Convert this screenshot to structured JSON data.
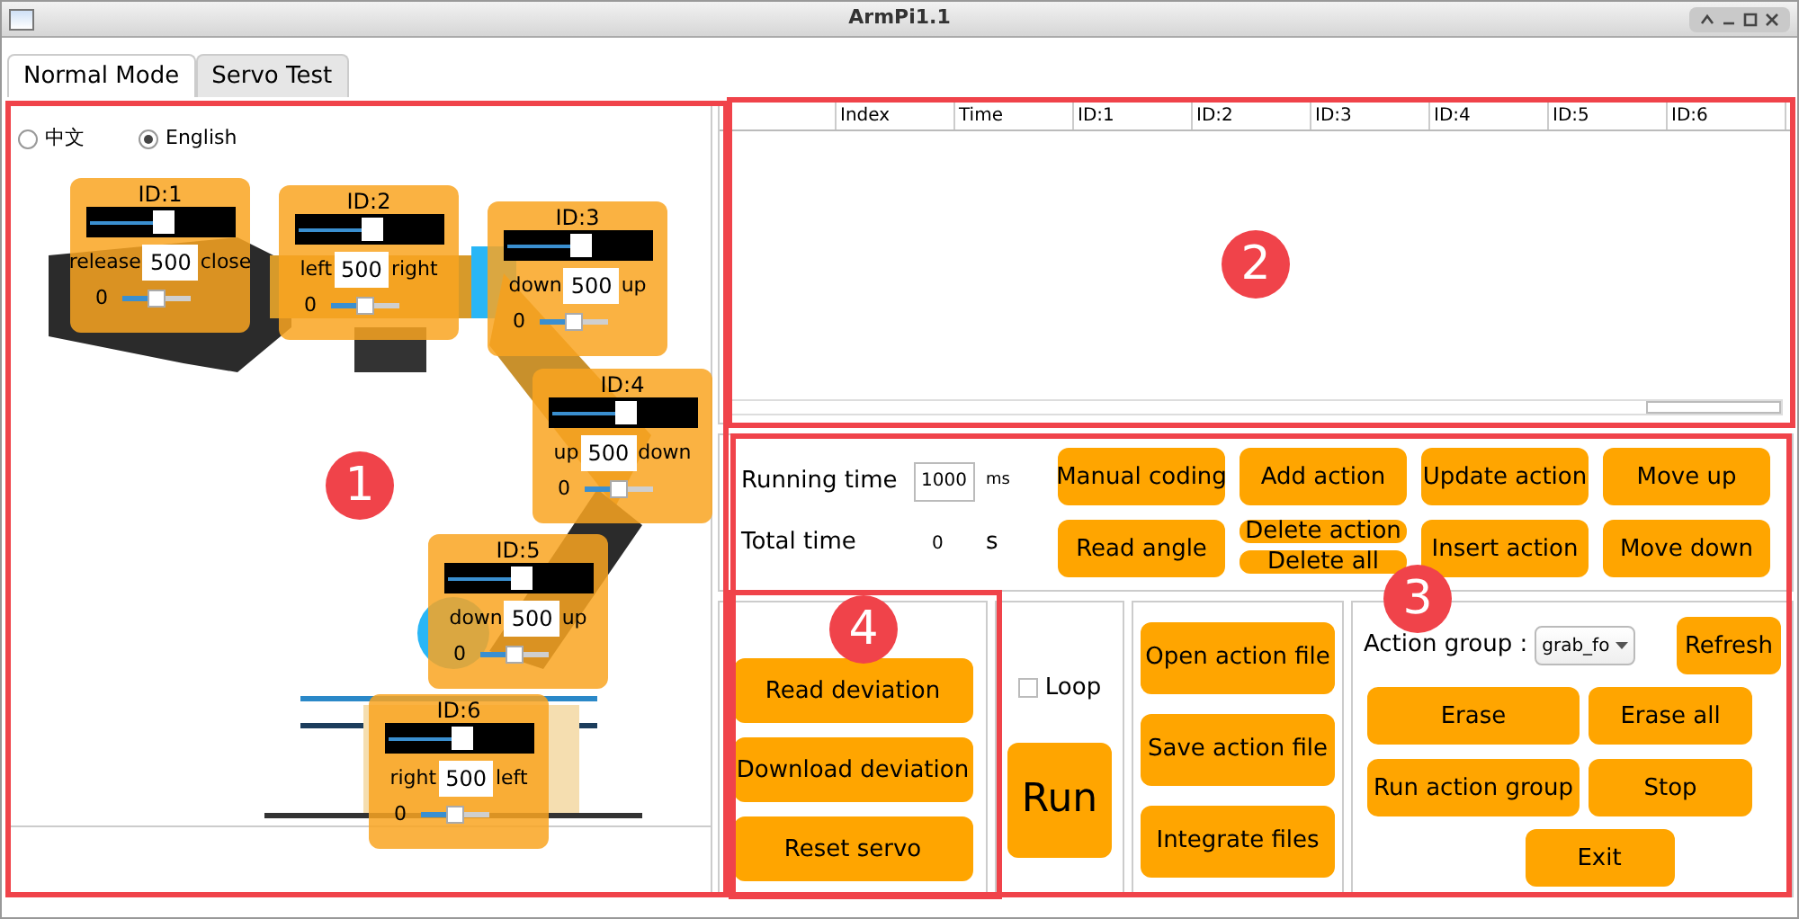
{
  "window": {
    "title": "ArmPi1.1"
  },
  "tabs": [
    {
      "label": "Normal Mode",
      "selected": true
    },
    {
      "label": "Servo Test",
      "selected": false
    }
  ],
  "languages": [
    {
      "label": "中文",
      "selected": false
    },
    {
      "label": "English",
      "selected": true
    }
  ],
  "servos": [
    {
      "id": "ID:1",
      "left": "release",
      "value": "500",
      "right": "close",
      "level": 0.55,
      "deviation": {
        "value": "0",
        "level": 0.5
      }
    },
    {
      "id": "ID:2",
      "left": "left",
      "value": "500",
      "right": "right",
      "level": 0.55,
      "deviation": {
        "value": "0",
        "level": 0.5
      }
    },
    {
      "id": "ID:3",
      "left": "down",
      "value": "500",
      "right": "up",
      "level": 0.55,
      "deviation": {
        "value": "0",
        "level": 0.5
      }
    },
    {
      "id": "ID:4",
      "left": "up",
      "value": "500",
      "right": "down",
      "level": 0.55,
      "deviation": {
        "value": "0",
        "level": 0.5
      }
    },
    {
      "id": "ID:5",
      "left": "down",
      "value": "500",
      "right": "up",
      "level": 0.55,
      "deviation": {
        "value": "0",
        "level": 0.5
      }
    },
    {
      "id": "ID:6",
      "left": "right",
      "value": "500",
      "right": "left",
      "level": 0.55,
      "deviation": {
        "value": "0",
        "level": 0.5
      }
    }
  ],
  "table": {
    "columns": [
      "Index",
      "Time",
      "ID:1",
      "ID:2",
      "ID:3",
      "ID:4",
      "ID:5",
      "ID:6"
    ]
  },
  "timing": {
    "running_label": "Running time",
    "running_value": "1000",
    "running_unit": "ms",
    "total_label": "Total time",
    "total_value": "0",
    "total_unit": "s"
  },
  "action_buttons": [
    [
      "Manual coding",
      "Read angle"
    ],
    [
      "Add action",
      [
        "Delete action",
        "Delete all"
      ]
    ],
    [
      "Update action",
      "Insert action"
    ],
    [
      "Move up",
      "Move down"
    ]
  ],
  "deviation_buttons": [
    "Read deviation",
    "Download deviation",
    "Reset servo"
  ],
  "loop": {
    "label": "Loop",
    "checked": false
  },
  "run_button": "Run",
  "file_buttons": [
    "Open action file",
    "Save action file",
    "Integrate files"
  ],
  "action_group": {
    "label": "Action group :",
    "value": "grab_fo",
    "refresh": "Refresh",
    "buttons": [
      "Erase",
      "Erase all",
      "Run action group",
      "Stop"
    ],
    "exit": "Exit"
  },
  "callouts": [
    {
      "label": "1"
    },
    {
      "label": "2"
    },
    {
      "label": "3"
    },
    {
      "label": "4"
    }
  ]
}
